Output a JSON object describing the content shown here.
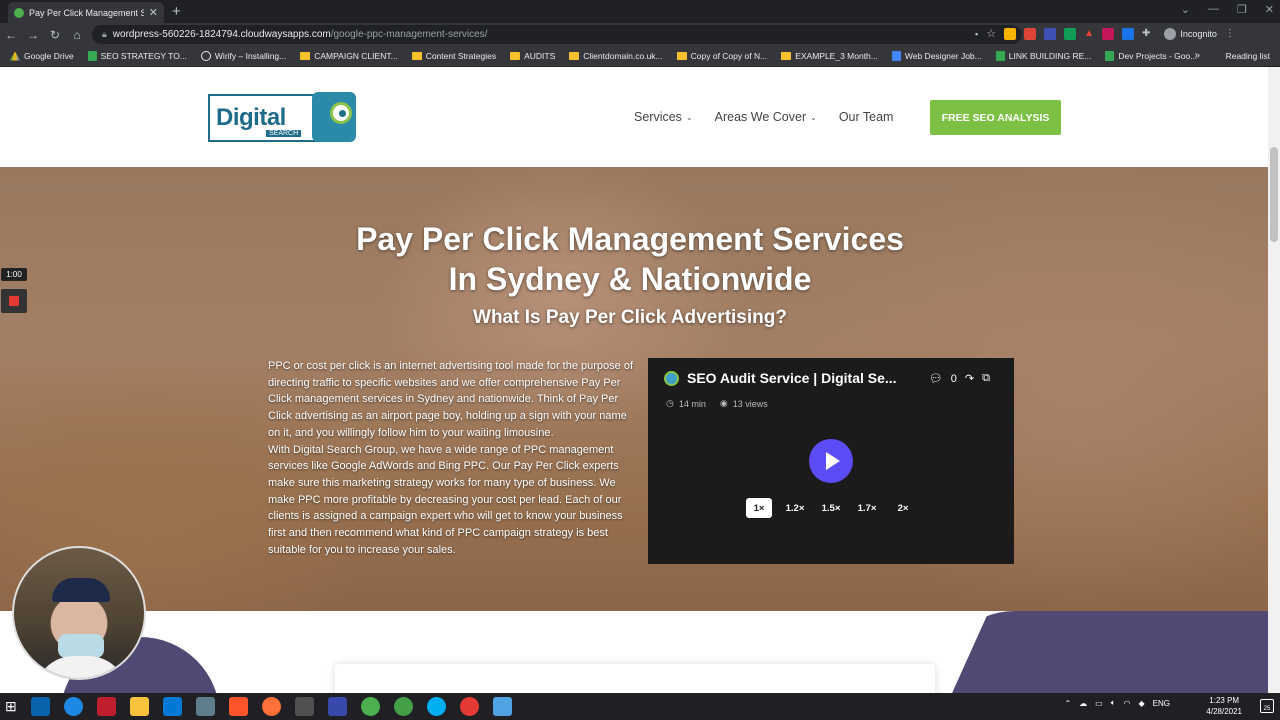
{
  "browser": {
    "tab_title": "Pay Per Click Management Servic",
    "url_host": "wordpress-560226-1824794.cloudwaysapps.com",
    "url_path": "/google-ppc-management-services/",
    "incognito_label": "Incognito",
    "bookmarks": [
      "Google Drive",
      "SEO STRATEGY TO...",
      "Wirify – Installing...",
      "CAMPAIGN CLIENT...",
      "Content Strategies",
      "AUDITS",
      "Clientdomain.co.uk...",
      "Copy of Copy of N...",
      "EXAMPLE_3 Month...",
      "Web Designer Job...",
      "LINK BUILDING RE...",
      "Dev Projects - Goo..."
    ],
    "reading_list": "Reading list"
  },
  "site": {
    "logo_text": "Digital",
    "logo_sub": "SEARCH",
    "nav": {
      "services": "Services",
      "areas": "Areas We Cover",
      "team": "Our Team"
    },
    "cta": "FREE SEO ANALYSIS"
  },
  "hero": {
    "title_line1": "Pay Per Click Management Services",
    "title_line2": "In Sydney & Nationwide",
    "subtitle": "What Is Pay Per Click Advertising?",
    "para1": "PPC or cost per click is an internet advertising tool made for the purpose of directing traffic to specific websites and we offer comprehensive Pay Per Click management services in Sydney and nationwide. Think of Pay Per Click advertising as an airport page boy, holding up a sign with your name on it, and you willingly follow him to your waiting limousine.",
    "para2": "With Digital Search Group, we have a wide range of PPC management services like Google AdWords and Bing PPC. Our Pay Per Click experts make sure this marketing strategy works for many type of business. We make PPC more profitable by decreasing your cost per lead. Each of our clients is assigned a campaign expert who will get to know your business first and then recommend what kind of PPC campaign strategy is best suitable for you to increase your sales."
  },
  "video": {
    "title": "SEO Audit Service | Digital Se...",
    "comments": "0",
    "duration": "14 min",
    "views": "13 views",
    "speeds": [
      "1×",
      "1.2×",
      "1.5×",
      "1.7×",
      "2×"
    ],
    "active_speed": "1×",
    "accent_color": "#5b4cf5"
  },
  "recorder": {
    "timer": "1:00"
  },
  "taskbar": {
    "time": "1:23 PM",
    "date": "4/28/2021",
    "lang": "ENG",
    "notifications": "25"
  }
}
